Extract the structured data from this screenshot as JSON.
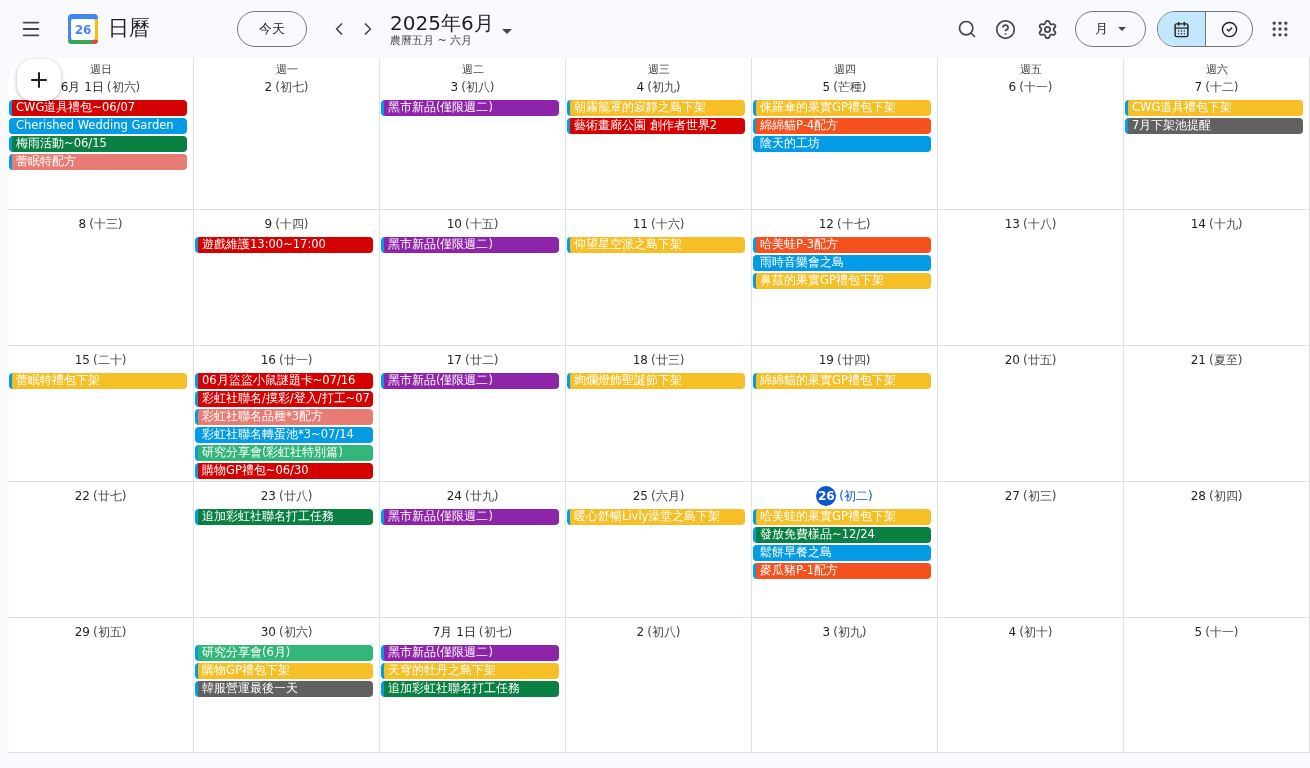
{
  "header": {
    "app_name": "日曆",
    "logo_day": "26",
    "today_button": "今天",
    "title": "2025年6月",
    "subtitle": "農曆五月 ~ 六月",
    "view_button": "月",
    "view_toggle": [
      {
        "kind": "calendar",
        "selected": true
      },
      {
        "kind": "tasks",
        "selected": false
      }
    ]
  },
  "weekdays": [
    "週日",
    "週一",
    "週二",
    "週三",
    "週四",
    "週五",
    "週六"
  ],
  "weeks": [
    [
      {
        "date": "6月 1日",
        "lunar": "(初六)",
        "today": false,
        "events": [
          {
            "title": "CWG道具禮包~06/07",
            "color": "#d50000"
          },
          {
            "title": "Cherished Wedding Garden",
            "color": "#039be5"
          },
          {
            "title": "梅雨活動~06/15",
            "color": "#0b8043"
          },
          {
            "title": "蕾眠特配方",
            "color": "#e67c73"
          }
        ]
      },
      {
        "date": "2",
        "lunar": "(初七)",
        "today": false
      },
      {
        "date": "3",
        "lunar": "(初八)",
        "today": false,
        "events": [
          {
            "title": "黑市新品(僅限週二)",
            "color": "#8e24aa"
          }
        ]
      },
      {
        "date": "4",
        "lunar": "(初九)",
        "today": false,
        "events": [
          {
            "title": "朝霧籠罩的寂靜之島下架",
            "color": "#f6bf26"
          },
          {
            "title": "藝術畫廊公園 創作者世界2",
            "color": "#d50000"
          }
        ]
      },
      {
        "date": "5",
        "lunar": "(芒種)",
        "today": false,
        "events": [
          {
            "title": "侏羅傘的果實GP禮包下架",
            "color": "#f6bf26"
          },
          {
            "title": "綿綿貓P-4配方",
            "color": "#f4511e"
          },
          {
            "title": "陰天的工坊",
            "color": "#039be5"
          }
        ]
      },
      {
        "date": "6",
        "lunar": "(十一)",
        "today": false
      },
      {
        "date": "7",
        "lunar": "(十二)",
        "today": false,
        "events": [
          {
            "title": "CWG道具禮包下架",
            "color": "#f6bf26"
          },
          {
            "title": "7月下架池提醒",
            "color": "#616161"
          }
        ]
      }
    ],
    [
      {
        "date": "8",
        "lunar": "(十三)",
        "today": false
      },
      {
        "date": "9",
        "lunar": "(十四)",
        "today": false,
        "events": [
          {
            "title": "遊戲維護13:00~17:00",
            "color": "#d50000"
          }
        ]
      },
      {
        "date": "10",
        "lunar": "(十五)",
        "today": false,
        "events": [
          {
            "title": "黑市新品(僅限週二)",
            "color": "#8e24aa"
          }
        ]
      },
      {
        "date": "11",
        "lunar": "(十六)",
        "today": false,
        "events": [
          {
            "title": "仰望星空派之島下架",
            "color": "#f6bf26"
          }
        ]
      },
      {
        "date": "12",
        "lunar": "(十七)",
        "today": false,
        "events": [
          {
            "title": "哈美蛙P-3配方",
            "color": "#f4511e"
          },
          {
            "title": "雨時音樂會之島",
            "color": "#039be5"
          },
          {
            "title": "鼻茲的果實GP禮包下架",
            "color": "#f6bf26"
          }
        ]
      },
      {
        "date": "13",
        "lunar": "(十八)",
        "today": false
      },
      {
        "date": "14",
        "lunar": "(十九)",
        "today": false
      }
    ],
    [
      {
        "date": "15",
        "lunar": "(二十)",
        "today": false,
        "events": [
          {
            "title": "蕾眠特禮包下架",
            "color": "#f6bf26"
          }
        ]
      },
      {
        "date": "16",
        "lunar": "(廿一)",
        "today": false,
        "events": [
          {
            "title": "06月盜盜小鼠謎題卡~07/16",
            "color": "#d50000"
          },
          {
            "title": "彩虹社聯名/摸彩/登入/打工~07",
            "color": "#d50000"
          },
          {
            "title": "彩虹社聯名品種*3配方",
            "color": "#e67c73"
          },
          {
            "title": "彩虹社聯名轉蛋池*3~07/14",
            "color": "#039be5"
          },
          {
            "title": "研究分享會(彩虹社特別篇)",
            "color": "#33b679"
          },
          {
            "title": "購物GP禮包~06/30",
            "color": "#d50000"
          }
        ]
      },
      {
        "date": "17",
        "lunar": "(廿二)",
        "today": false,
        "events": [
          {
            "title": "黑市新品(僅限週二)",
            "color": "#8e24aa"
          }
        ]
      },
      {
        "date": "18",
        "lunar": "(廿三)",
        "today": false,
        "events": [
          {
            "title": "絢爛燈飾聖誕節下架",
            "color": "#f6bf26"
          }
        ]
      },
      {
        "date": "19",
        "lunar": "(廿四)",
        "today": false,
        "events": [
          {
            "title": "綿綿貓的果實GP禮包下架",
            "color": "#f6bf26"
          }
        ]
      },
      {
        "date": "20",
        "lunar": "(廿五)",
        "today": false
      },
      {
        "date": "21",
        "lunar": "(夏至)",
        "today": false
      }
    ],
    [
      {
        "date": "22",
        "lunar": "(廿七)",
        "today": false
      },
      {
        "date": "23",
        "lunar": "(廿八)",
        "today": false,
        "events": [
          {
            "title": "追加彩虹社聯名打工任務",
            "color": "#0b8043"
          }
        ]
      },
      {
        "date": "24",
        "lunar": "(廿九)",
        "today": false,
        "events": [
          {
            "title": "黑市新品(僅限週二)",
            "color": "#8e24aa"
          }
        ]
      },
      {
        "date": "25",
        "lunar": "(六月)",
        "today": false,
        "events": [
          {
            "title": "暖心舒暢Livly澡堂之島下架",
            "color": "#f6bf26"
          }
        ]
      },
      {
        "date": "26",
        "lunar": "(初二)",
        "today": true,
        "events": [
          {
            "title": "哈美蛙的果實GP禮包下架",
            "color": "#f6bf26"
          },
          {
            "title": "發放免費樣品~12/24",
            "color": "#0b8043"
          },
          {
            "title": "鬆餅早餐之島",
            "color": "#039be5"
          },
          {
            "title": "麥瓜豬P-1配方",
            "color": "#f4511e"
          }
        ]
      },
      {
        "date": "27",
        "lunar": "(初三)",
        "today": false
      },
      {
        "date": "28",
        "lunar": "(初四)",
        "today": false
      }
    ],
    [
      {
        "date": "29",
        "lunar": "(初五)",
        "today": false
      },
      {
        "date": "30",
        "lunar": "(初六)",
        "today": false,
        "events": [
          {
            "title": "研究分享會(6月)",
            "color": "#33b679"
          },
          {
            "title": "購物GP禮包下架",
            "color": "#f6bf26"
          },
          {
            "title": "韓服營運最後一天",
            "color": "#616161"
          }
        ]
      },
      {
        "date": "7月 1日",
        "lunar": "(初七)",
        "today": false,
        "events": [
          {
            "title": "黑市新品(僅限週二)",
            "color": "#8e24aa"
          },
          {
            "title": "天穹的牡丹之島下架",
            "color": "#f6bf26"
          },
          {
            "title": "追加彩虹社聯名打工任務",
            "color": "#0b8043"
          }
        ]
      },
      {
        "date": "2",
        "lunar": "(初八)",
        "today": false
      },
      {
        "date": "3",
        "lunar": "(初九)",
        "today": false
      },
      {
        "date": "4",
        "lunar": "(初十)",
        "today": false
      },
      {
        "date": "5",
        "lunar": "(十一)",
        "today": false
      }
    ]
  ]
}
